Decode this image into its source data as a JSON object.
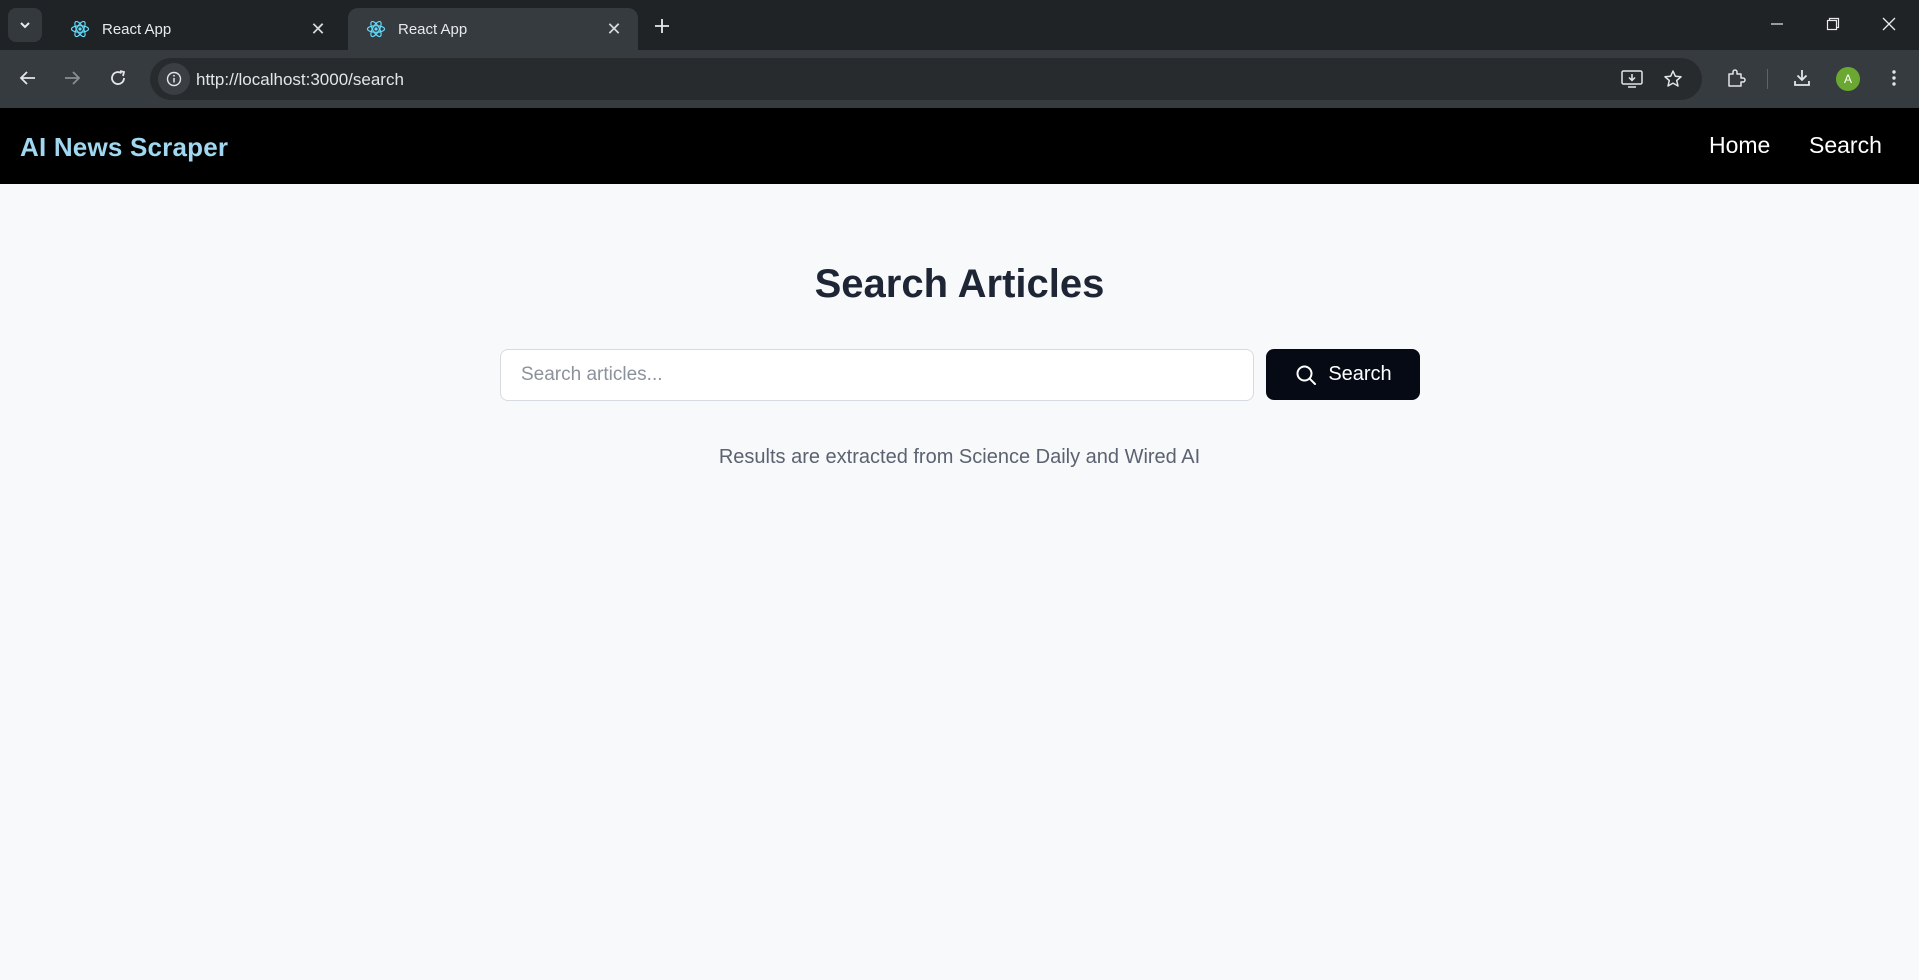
{
  "browser": {
    "tabs": [
      {
        "title": "React App",
        "active": false
      },
      {
        "title": "React App",
        "active": true
      }
    ],
    "url": "http://localhost:3000/search",
    "profile_initial": "A"
  },
  "app": {
    "brand": "AI News Scraper",
    "nav_links": {
      "home": "Home",
      "search": "Search"
    },
    "page_title": "Search Articles",
    "search": {
      "placeholder": "Search articles...",
      "value": "",
      "button_label": "Search"
    },
    "subtitle": "Results are extracted from Science Daily and Wired AI"
  },
  "colors": {
    "brand": "#9fd8f0",
    "nav_background": "#000000",
    "page_background": "#f8f9fb",
    "button_background": "#050a14"
  }
}
